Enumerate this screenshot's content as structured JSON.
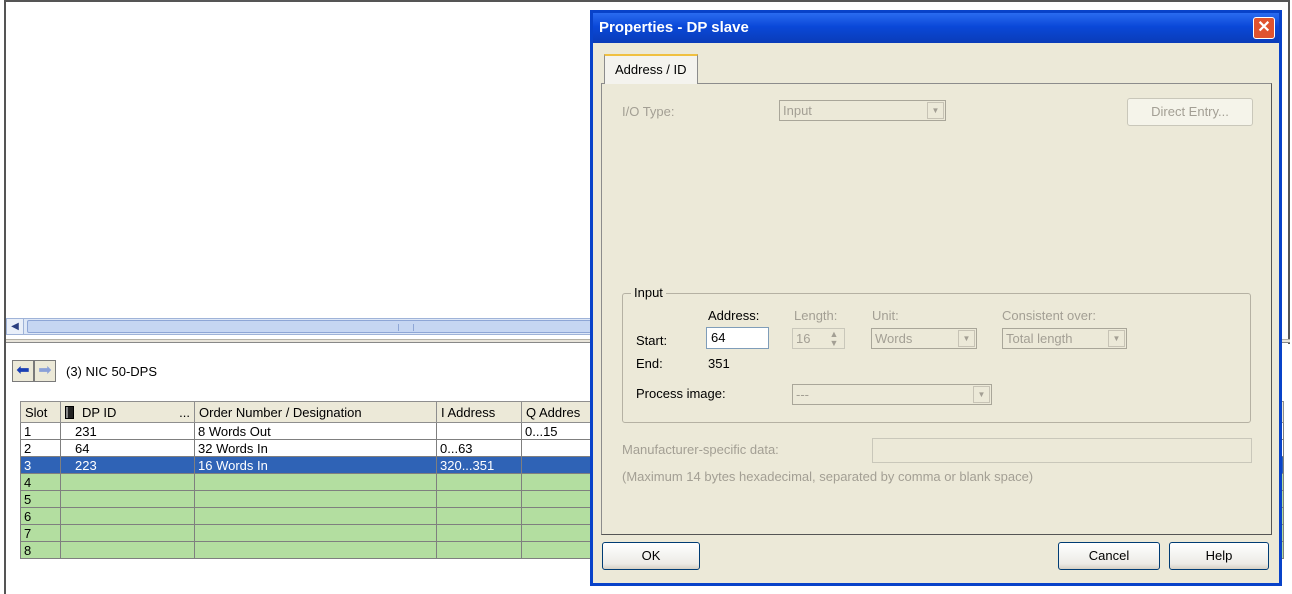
{
  "station": {
    "label": "(3)  NIC 50-DPS"
  },
  "table": {
    "headers": {
      "slot": "Slot",
      "dp_id": "DP ID",
      "dp_id_more": "...",
      "order": "Order Number / Designation",
      "i_addr": "I Address",
      "q_addr": "Q Addres"
    },
    "rows": [
      {
        "slot": "1",
        "dp_id": "231",
        "order": "8  Words Out",
        "i_addr": "",
        "q_addr": "0...15"
      },
      {
        "slot": "2",
        "dp_id": "64",
        "order": "32 Words In",
        "i_addr": "0...63",
        "q_addr": ""
      },
      {
        "slot": "3",
        "dp_id": "223",
        "order": "16 Words In",
        "i_addr": "320...351",
        "q_addr": ""
      },
      {
        "slot": "4",
        "dp_id": "",
        "order": "",
        "i_addr": "",
        "q_addr": ""
      },
      {
        "slot": "5",
        "dp_id": "",
        "order": "",
        "i_addr": "",
        "q_addr": ""
      },
      {
        "slot": "6",
        "dp_id": "",
        "order": "",
        "i_addr": "",
        "q_addr": ""
      },
      {
        "slot": "7",
        "dp_id": "",
        "order": "",
        "i_addr": "",
        "q_addr": ""
      },
      {
        "slot": "8",
        "dp_id": "",
        "order": "",
        "i_addr": "",
        "q_addr": ""
      }
    ]
  },
  "dialog": {
    "title": "Properties - DP slave",
    "close_glyph": "✕",
    "tab": "Address / ID",
    "io_type": {
      "label": "I/O Type:",
      "value": "Input"
    },
    "direct_entry": "Direct Entry...",
    "input_group": {
      "legend": "Input",
      "address_header": "Address:",
      "length_header": "Length:",
      "unit_header": "Unit:",
      "consistent_header": "Consistent over:",
      "start_label": "Start:",
      "start_value": "64",
      "length_value": "16",
      "unit_value": "Words",
      "consistent_value": "Total length",
      "end_label": "End:",
      "end_value": "351",
      "process_image_label": "Process image:",
      "process_image_value": "---"
    },
    "manufacturer": {
      "label": "Manufacturer-specific data:",
      "value": "",
      "hint": "(Maximum 14 bytes hexadecimal, separated by comma or blank space)"
    },
    "buttons": {
      "ok": "OK",
      "cancel": "Cancel",
      "help": "Help"
    }
  },
  "colors": {
    "selected_row": "#2f63b6",
    "empty_slot": "#b3dea0",
    "dialog_face": "#ece9d8",
    "titlebar": "#0a48d8"
  }
}
